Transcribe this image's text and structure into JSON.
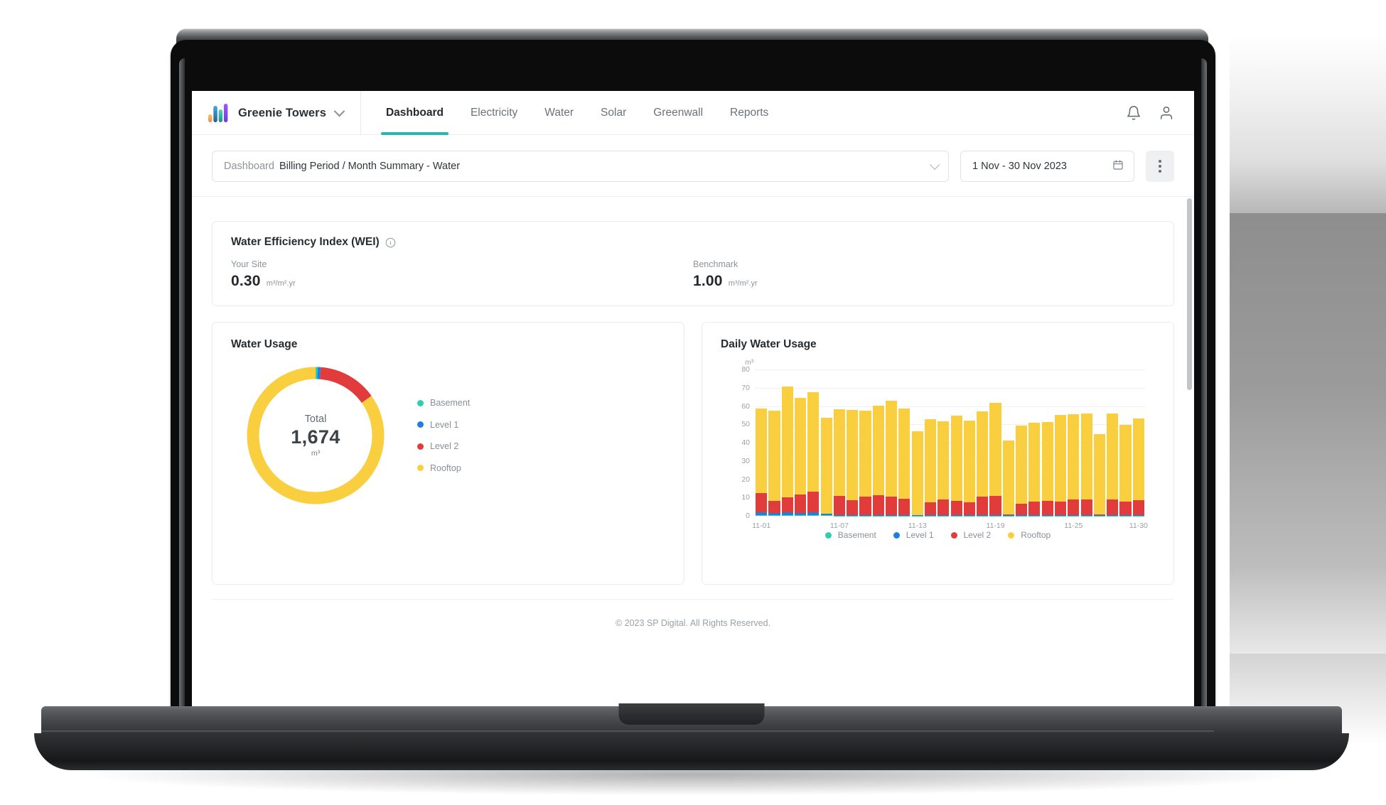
{
  "header": {
    "brand_name": "Greenie Towers",
    "brand_chevron_icon": "chevron-down-icon",
    "logo_icon": "bar-chart-logo-icon",
    "tabs": [
      {
        "label": "Dashboard",
        "active": true
      },
      {
        "label": "Electricity",
        "active": false
      },
      {
        "label": "Water",
        "active": false
      },
      {
        "label": "Solar",
        "active": false
      },
      {
        "label": "Greenwall",
        "active": false
      },
      {
        "label": "Reports",
        "active": false
      }
    ],
    "notification_icon": "bell-icon",
    "account_icon": "user-icon",
    "active_tab_color": "#2cb5a8"
  },
  "filter_bar": {
    "dashboard_select": {
      "lead_label": "Dashboard",
      "value": "Billing Period / Month Summary - Water",
      "chevron_icon": "chevron-down-icon"
    },
    "date_range": {
      "value": "1 Nov - 30 Nov 2023",
      "calendar_icon": "calendar-icon"
    },
    "more_menu": {
      "icon": "kebab-menu-icon",
      "label": "More options"
    }
  },
  "wei_card": {
    "title": "Water Efficiency Index (WEI)",
    "info_icon": "info-circle-icon",
    "your_site": {
      "label": "Your Site",
      "value": "0.30",
      "unit": "m³/m².yr"
    },
    "benchmark": {
      "label": "Benchmark",
      "value": "1.00",
      "unit": "m³/m².yr"
    }
  },
  "footer": {
    "text": "© 2023 SP Digital. All Rights Reserved."
  },
  "colors": {
    "basement": "#2ecfb0",
    "level1": "#1f7fe0",
    "level2": "#e23b3b",
    "rooftop": "#f9cf3f",
    "accent": "#2cb5a8"
  },
  "chart_data": [
    {
      "type": "pie",
      "title": "Water Usage",
      "center_label": "Total",
      "center_value": "1,674",
      "center_unit": "m³",
      "total": 1674,
      "legend_position": "right",
      "categories": [
        "Basement",
        "Level 1",
        "Level 2",
        "Rooftop"
      ],
      "values": [
        8,
        12,
        234,
        1420
      ],
      "colors": [
        "#2ecfb0",
        "#1f7fe0",
        "#e23b3b",
        "#f9cf3f"
      ]
    },
    {
      "type": "bar",
      "stacked": true,
      "title": "Daily Water Usage",
      "xlabel": "",
      "ylabel": "m³",
      "ylim": [
        0,
        80
      ],
      "yticks": [
        0,
        10,
        20,
        30,
        40,
        50,
        60,
        70,
        80
      ],
      "grid": true,
      "legend_position": "bottom",
      "x": [
        "11-01",
        "11-02",
        "11-03",
        "11-04",
        "11-05",
        "11-06",
        "11-07",
        "11-08",
        "11-09",
        "11-10",
        "11-11",
        "11-12",
        "11-13",
        "11-14",
        "11-15",
        "11-16",
        "11-17",
        "11-18",
        "11-19",
        "11-20",
        "11-21",
        "11-22",
        "11-23",
        "11-24",
        "11-25",
        "11-26",
        "11-27",
        "11-28",
        "11-29",
        "11-30"
      ],
      "xtick_labels": [
        "11-01",
        "11-07",
        "11-13",
        "11-19",
        "11-25",
        "11-30"
      ],
      "series": [
        {
          "name": "Basement",
          "color": "#2ecfb0",
          "values": [
            0.3,
            0.3,
            0.3,
            0.3,
            0.3,
            0.3,
            0.2,
            0.2,
            0.2,
            0.2,
            0.2,
            0.2,
            0.2,
            0.2,
            0.2,
            0.2,
            0.2,
            0.2,
            0.2,
            0.2,
            0.2,
            0.2,
            0.2,
            0.2,
            0.2,
            0.2,
            0.2,
            0.2,
            0.2,
            0.2
          ]
        },
        {
          "name": "Level 1",
          "color": "#1f7fe0",
          "values": [
            1.5,
            1.4,
            1.6,
            1.4,
            1.6,
            0.7,
            0.1,
            0.1,
            0.1,
            0.1,
            0.1,
            0.1,
            0.1,
            0.1,
            0.1,
            0.1,
            0.1,
            0.1,
            0.1,
            0.1,
            0.1,
            0.1,
            0.1,
            0.1,
            0.1,
            0.1,
            0.1,
            0.1,
            0.1,
            0.1
          ]
        },
        {
          "name": "Level 2",
          "color": "#e23b3b",
          "values": [
            10.8,
            6.4,
            8.2,
            9.8,
            11.5,
            0.2,
            10.6,
            8.4,
            10.2,
            10.8,
            10.3,
            9.2,
            0.2,
            7.2,
            8.5,
            7.8,
            7.2,
            10.2,
            10.4,
            0.4,
            6.3,
            7.3,
            7.9,
            7.3,
            8.6,
            8.5,
            0.3,
            8.6,
            7.3,
            8.4
          ]
        },
        {
          "name": "Rooftop",
          "color": "#f9cf3f",
          "values": [
            46.0,
            49.3,
            60.6,
            53.1,
            54.1,
            52.5,
            47.2,
            49.1,
            47.1,
            49.1,
            52.5,
            49.3,
            45.8,
            45.5,
            42.7,
            46.5,
            44.7,
            46.5,
            51.0,
            40.4,
            42.9,
            43.3,
            42.9,
            47.4,
            46.8,
            47.0,
            44.0,
            47.1,
            42.3,
            44.7
          ]
        }
      ]
    }
  ]
}
